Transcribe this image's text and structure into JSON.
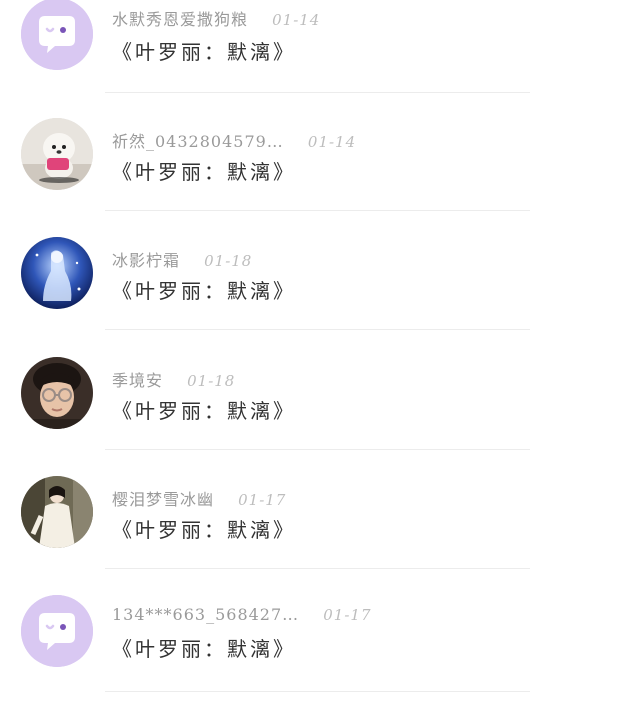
{
  "comments": [
    {
      "avatar": "chat-bubble-icon",
      "name": "水默秀恩爱撒狗粮",
      "date": "01-14",
      "text": "《叶罗丽：默漓》"
    },
    {
      "avatar": "white-puppy-photo",
      "name": "祈然_0432804579…",
      "date": "01-14",
      "text": "《叶罗丽：默漓》"
    },
    {
      "avatar": "blue-fairy-photo",
      "name": "冰影柠霜",
      "date": "01-18",
      "text": "《叶罗丽：默漓》"
    },
    {
      "avatar": "boy-glasses-photo",
      "name": "季境安",
      "date": "01-18",
      "text": "《叶罗丽：默漓》"
    },
    {
      "avatar": "girl-white-dress-photo",
      "name": "樱泪梦雪冰幽",
      "date": "01-17",
      "text": "《叶罗丽：默漓》"
    },
    {
      "avatar": "chat-bubble-icon",
      "name": "134***663_568427…",
      "date": "01-17",
      "text": "《叶罗丽：默漓》"
    }
  ],
  "colors": {
    "avatar_purple": "#d9c8f2",
    "name": "#9a9a9a",
    "date": "#bdbdbd",
    "text": "#333333"
  }
}
